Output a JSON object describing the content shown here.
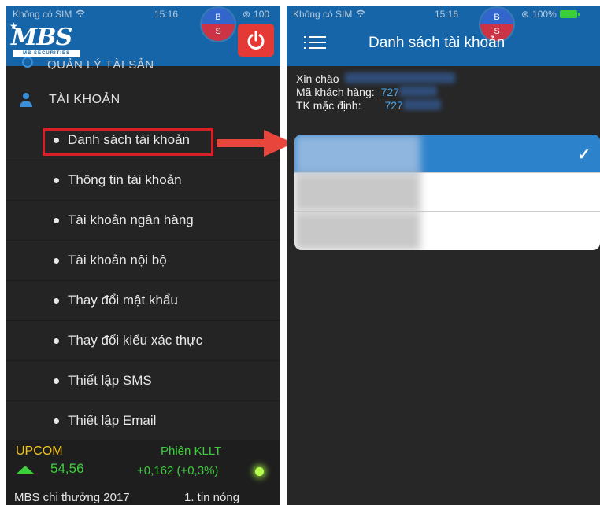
{
  "left_phone": {
    "status": {
      "carrier": "Không có SIM",
      "time": "15:16",
      "battery_text": "100"
    },
    "logo": {
      "brand": "MBS",
      "tagline": "MB SECURITIES"
    },
    "bs_badge": {
      "top": "B",
      "bottom": "S"
    },
    "partial_menu_label": "QUẢN LÝ TÀI SẢN",
    "section_label": "TÀI KHOẢN",
    "submenu": [
      {
        "label": "Danh sách tài khoản",
        "highlighted": true
      },
      {
        "label": "Thông tin tài khoản"
      },
      {
        "label": "Tài khoản ngân hàng"
      },
      {
        "label": "Tài khoản nội bộ"
      },
      {
        "label": "Thay đổi mật khẩu"
      },
      {
        "label": "Thay đổi kiểu xác thực"
      },
      {
        "label": "Thiết lập SMS"
      },
      {
        "label": "Thiết lập Email"
      }
    ],
    "ticker": {
      "index_name": "UPCOM",
      "session": "Phiên KLLT",
      "value": "54,56",
      "change": "+0,162 (+0,3%)",
      "news_text": "MBS chi thưởng 2017",
      "hot_news": "1. tin nóng"
    },
    "colors": {
      "header": "#1565a8",
      "highlight_border": "#d61f26",
      "up": "#3ccf3c",
      "index": "#f0c419"
    }
  },
  "right_phone": {
    "status": {
      "carrier": "Không có SIM",
      "time": "15:16",
      "battery_text": "100%"
    },
    "bs_badge": {
      "top": "B",
      "bottom": "S"
    },
    "title": "Danh sách tài khoản",
    "greeting_label": "Xin chào",
    "customer_code_label": "Mã khách hàng:",
    "customer_code_value": "727",
    "default_account_label": "TK mặc định:",
    "default_account_value": "727",
    "accounts": [
      {
        "selected": true,
        "check": "✓"
      },
      {
        "selected": false
      },
      {
        "selected": false
      }
    ],
    "colors": {
      "selected_row": "#2d82cc",
      "account_value": "#4aa8f0"
    }
  }
}
